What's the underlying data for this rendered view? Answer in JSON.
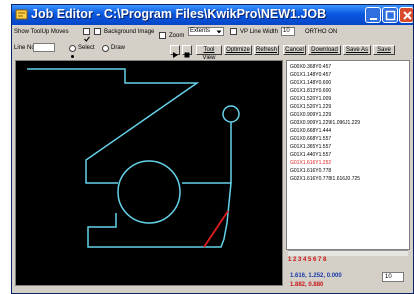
{
  "window": {
    "title": "Job Editor - C:\\Program Files\\KwikPro\\NEW1.JOB"
  },
  "options": {
    "show_tool_moves": "Show ToolUp Moves",
    "background_image": "Background Image",
    "zoom": "Zoom",
    "zoom_value": "Extents",
    "vp_line_width": "VP Line Width",
    "vp_line_width_value": "10",
    "ortho": "ORTHO ON",
    "line_no": "Line No:",
    "select": "Select",
    "draw": "Draw"
  },
  "toolbar": {
    "tool_view": "Tool View",
    "optimize": "Optimize",
    "refresh": "Refresh",
    "cancel": "Cancel",
    "download": "Download",
    "save_as": "Save As",
    "save": "Save"
  },
  "code_lines": [
    {
      "text": "G00X0.368Y0.457",
      "highlight": false
    },
    {
      "text": "G01X1.148Y0.457",
      "highlight": false
    },
    {
      "text": "G01X1.148Y0.600",
      "highlight": false
    },
    {
      "text": "G01X1.813Y0.600",
      "highlight": false
    },
    {
      "text": "G01X1.520Y1.009",
      "highlight": false
    },
    {
      "text": "G01X1.520Y1.229",
      "highlight": false
    },
    {
      "text": "G01X0.909Y1.229",
      "highlight": false
    },
    {
      "text": "G03X0.909Y1.229I1.096J1.229",
      "highlight": false
    },
    {
      "text": "G01X0.668Y1.444",
      "highlight": false
    },
    {
      "text": "G01X0.668Y1.557",
      "highlight": false
    },
    {
      "text": "G01X1.365Y1.557",
      "highlight": false
    },
    {
      "text": "G01X1.440Y1.557",
      "highlight": false
    },
    {
      "text": "G01X1.616Y1.252",
      "highlight": true
    },
    {
      "text": "G01X1.616Y0.778",
      "highlight": false
    },
    {
      "text": "G02X1.616Y0.778I1.616J0.725",
      "highlight": false
    }
  ],
  "number_row": "1 2 3 4 5 6 7 8",
  "line_box_value": "10",
  "coords": {
    "primary": "1.616, 1.252, 0.000",
    "secondary": "1.882, 0.880"
  },
  "colors": {
    "toolpath": "#64d2e8",
    "active_segment": "#d21e1e",
    "highlight_text": "#e02020"
  }
}
